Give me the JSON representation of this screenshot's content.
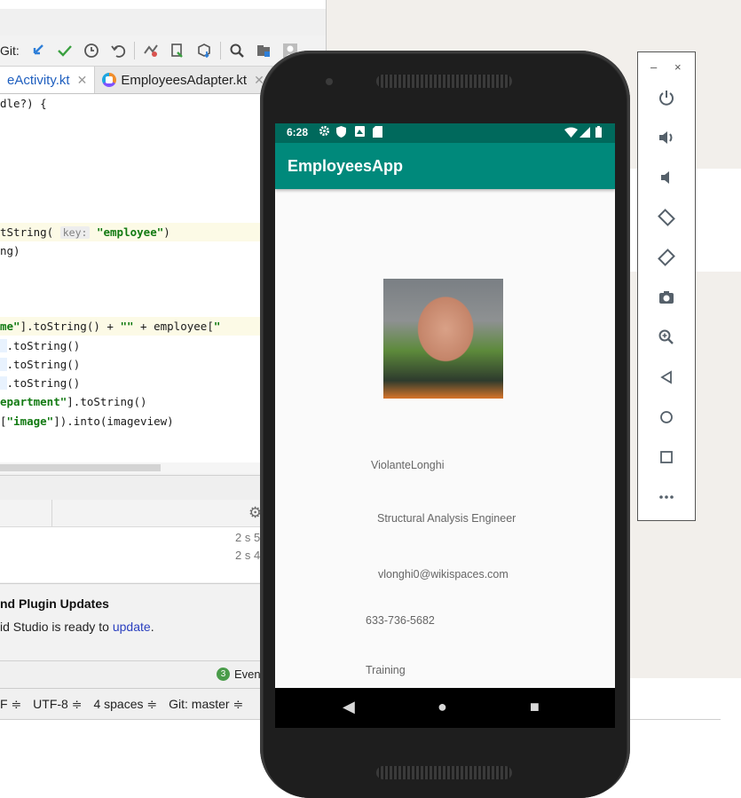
{
  "ide": {
    "toolbar": {
      "git_label": "Git:",
      "icons": [
        "update-project-icon",
        "commit-icon",
        "history-icon",
        "rollback-icon",
        "compare-icon",
        "device-file-icon",
        "package-icon",
        "search-icon",
        "project-structure-icon",
        "profile-icon"
      ]
    },
    "tabs": [
      {
        "label": "eActivity.kt"
      },
      {
        "label": "EmployeesAdapter.kt"
      }
    ],
    "code_lines": [
      "dle?) {",
      "",
      "",
      "",
      "",
      "",
      "",
      "",
      "",
      "",
      "",
      "",
      "",
      "",
      "",
      "",
      "",
      "",
      ""
    ],
    "code": {
      "l1": "dle?) {",
      "l2a": "tString(",
      "l2hint": "key:",
      "l2str": "\"employee\"",
      "l2b": ")",
      "l3": "ng)",
      "l4str": "me\"",
      "l4a": "].toString() + ",
      "l4str2": "\"\"",
      "l4b": " + employee[",
      "l4str3": "\"",
      "l5": ".toString()",
      "l6": ".toString()",
      "l7": ".toString()",
      "l8str": "epartment\"",
      "l8a": "].toString()",
      "l9a": "[",
      "l9str": "\"image\"",
      "l9b": "]).into(imageview)"
    },
    "run_times": [
      "2 s 5",
      "2 s 4"
    ],
    "notification": {
      "title": "nd Plugin Updates",
      "body_prefix": "id Studio is ready to ",
      "link": "update",
      "body_suffix": "."
    },
    "event_log": {
      "count": "3",
      "label": "Even"
    },
    "status_bar": {
      "line_sep": "F ≑",
      "encoding": "UTF-8 ≑",
      "indent": "4 spaces ≑",
      "git": "Git: master ≑"
    }
  },
  "emulator_controls": {
    "minimize": "–",
    "close": "×",
    "buttons": [
      "power-icon",
      "volume-up-icon",
      "volume-down-icon",
      "rotate-left-icon",
      "rotate-right-icon",
      "camera-icon",
      "zoom-icon",
      "back-icon",
      "home-icon",
      "overview-icon",
      "more-icon"
    ]
  },
  "phone": {
    "status_time": "6:28",
    "app_title": "EmployeesApp",
    "employee": {
      "name": "ViolanteLonghi",
      "title": "Structural Analysis Engineer",
      "email": "vlonghi0@wikispaces.com",
      "phone": "633-736-5682",
      "department": "Training"
    },
    "colors": {
      "status_bar": "#00695c",
      "app_bar": "#00897b"
    }
  }
}
